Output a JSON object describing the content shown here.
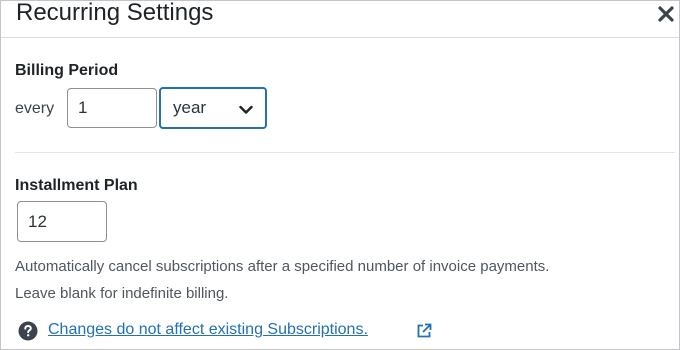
{
  "modal": {
    "title": "Recurring Settings",
    "close_icon": "close-icon"
  },
  "billing_period": {
    "label": "Billing Period",
    "prefix": "every",
    "interval_value": "1",
    "unit_selected": "year"
  },
  "installment_plan": {
    "label": "Installment Plan",
    "count_value": "12",
    "help_line_1": "Automatically cancel subscriptions after a specified number of invoice payments.",
    "help_line_2": "Leave blank for indefinite billing."
  },
  "footer_help": {
    "icon": "question-circle-icon",
    "link_text": "Changes do not affect existing Subscriptions.",
    "link_icon": "external-link-icon"
  },
  "colors": {
    "accent": "#2271b1",
    "text": "#1d2327",
    "muted_text": "#50575e",
    "border": "#8c8f94",
    "divider": "#e5e5e5"
  }
}
